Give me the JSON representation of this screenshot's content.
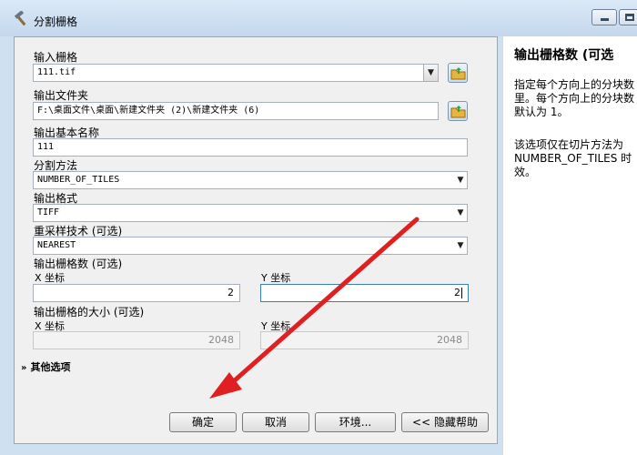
{
  "window": {
    "title": "分割栅格",
    "icon": "hammer-icon"
  },
  "form": {
    "input_raster": {
      "label": "输入栅格",
      "value": "111.tif"
    },
    "output_folder": {
      "label": "输出文件夹",
      "value": "F:\\桌面文件\\桌面\\新建文件夹 (2)\\新建文件夹 (6)"
    },
    "output_base_name": {
      "label": "输出基本名称",
      "value": "111"
    },
    "split_method": {
      "label": "分割方法",
      "value": "NUMBER_OF_TILES"
    },
    "output_format": {
      "label": "输出格式",
      "value": "TIFF"
    },
    "resampling": {
      "label": "重采样技术 (可选)",
      "value": "NEAREST"
    },
    "num_rasters": {
      "label": "输出栅格数 (可选)",
      "x_label": "X 坐标",
      "x_value": "2",
      "y_label": "Y 坐标",
      "y_value": "2"
    },
    "tile_size": {
      "label": "输出栅格的大小 (可选)",
      "x_label": "X 坐标",
      "x_value": "2048",
      "y_label": "Y 坐标",
      "y_value": "2048"
    },
    "more_options": "其他选项"
  },
  "buttons": {
    "ok": "确定",
    "cancel": "取消",
    "environments": "环境...",
    "hide_help": "<< 隐藏帮助"
  },
  "help": {
    "title": "输出栅格数 (可选",
    "para1": [
      "指定每个方向上的分块数",
      "里。每个方向上的分块数",
      "默认为 1。"
    ],
    "para2": [
      "该选项仅在切片方法为",
      "NUMBER_OF_TILES 时",
      "效。"
    ]
  },
  "colors": {
    "annotation_arrow": "#e02020",
    "title_bar": "#cfe0f1"
  }
}
